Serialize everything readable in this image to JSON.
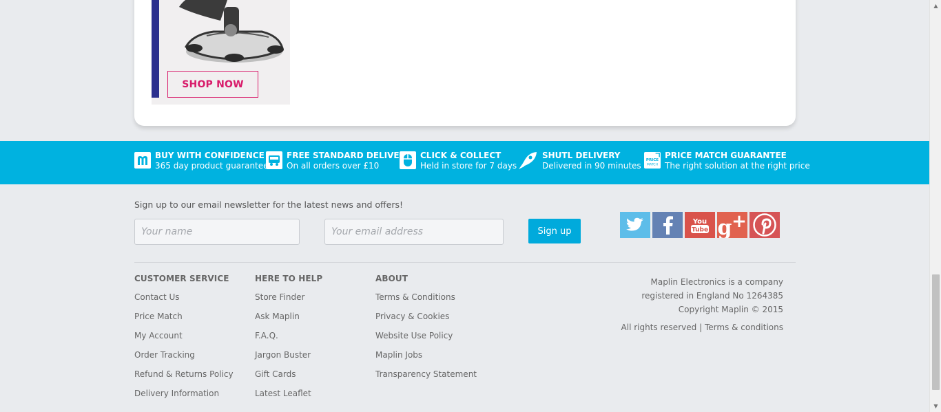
{
  "promo": {
    "button_label": "SHOP NOW",
    "image_icon": "joystick-image"
  },
  "benefits": [
    {
      "icon": "maplin-m-icon",
      "title": "BUY WITH CONFIDENCE",
      "subtitle": "365 day product guarantee"
    },
    {
      "icon": "delivery-van-icon",
      "title": "FREE STANDARD DELIVERY",
      "subtitle": "On all orders over £10"
    },
    {
      "icon": "mouse-click-icon",
      "title": "CLICK & COLLECT",
      "subtitle": "Held in store for 7 days"
    },
    {
      "icon": "rocket-icon",
      "title": "SHUTL DELIVERY",
      "subtitle": "Delivered in 90 minutes"
    },
    {
      "icon": "price-match-icon",
      "title": "PRICE MATCH GUARANTEE",
      "subtitle": "The right solution at the right price"
    }
  ],
  "newsletter": {
    "label": "Sign up to our email newsletter for the latest news and offers!",
    "name_placeholder": "Your name",
    "email_placeholder": "Your email address",
    "button_label": "Sign up"
  },
  "social": [
    {
      "name": "twitter-icon",
      "glyph": "t",
      "color": "#5dbde9"
    },
    {
      "name": "facebook-icon",
      "glyph": "f",
      "color": "#6482b4"
    },
    {
      "name": "youtube-icon",
      "glyph": "You Tube",
      "color": "#d9534b"
    },
    {
      "name": "google-plus-icon",
      "glyph": "g+",
      "color": "#e1624f"
    },
    {
      "name": "pinterest-icon",
      "glyph": "P",
      "color": "#d65456"
    }
  ],
  "footer": {
    "columns": [
      {
        "heading": "CUSTOMER SERVICE",
        "links": [
          "Contact Us",
          "Price Match",
          "My Account",
          "Order Tracking",
          "Refund & Returns Policy",
          "Delivery Information"
        ]
      },
      {
        "heading": "HERE TO HELP",
        "links": [
          "Store Finder",
          "Ask Maplin",
          "F.A.Q.",
          "Jargon Buster",
          "Gift Cards",
          "Latest Leaflet"
        ]
      },
      {
        "heading": "ABOUT",
        "links": [
          "Terms & Conditions",
          "Privacy & Cookies",
          "Website Use Policy",
          "Maplin Jobs",
          "Transparency Statement"
        ]
      }
    ],
    "company_lines": [
      "Maplin Electronics is a company",
      "registered in England No 1264385",
      "Copyright Maplin © 2015"
    ],
    "rights_text": "All rights reserved",
    "separator": "|",
    "terms_link": "Terms & conditions"
  },
  "colors": {
    "strip": "#00b2e0",
    "accent_pink": "#d81b6a",
    "promo_bar": "#2b2f8e"
  }
}
